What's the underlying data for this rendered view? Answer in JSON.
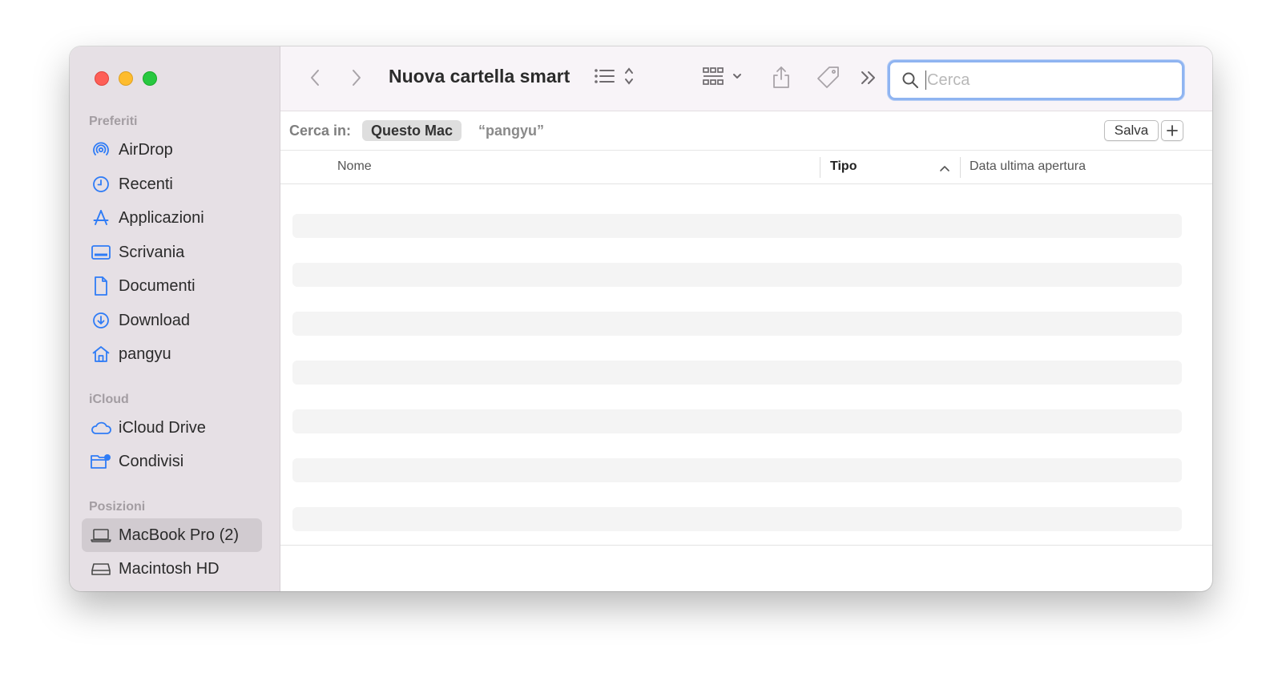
{
  "window": {
    "title": "Nuova cartella smart"
  },
  "sidebar": {
    "sections": {
      "favorites": "Preferiti",
      "icloud": "iCloud",
      "locations": "Posizioni"
    },
    "favorites": [
      {
        "label": "AirDrop",
        "icon": "airdrop-icon"
      },
      {
        "label": "Recenti",
        "icon": "clock-icon"
      },
      {
        "label": "Applicazioni",
        "icon": "apps-icon"
      },
      {
        "label": "Scrivania",
        "icon": "desktop-icon"
      },
      {
        "label": "Documenti",
        "icon": "document-icon"
      },
      {
        "label": "Download",
        "icon": "download-icon"
      },
      {
        "label": "pangyu",
        "icon": "home-icon"
      }
    ],
    "icloud": [
      {
        "label": "iCloud Drive",
        "icon": "cloud-icon"
      },
      {
        "label": "Condivisi",
        "icon": "shared-folder-icon"
      }
    ],
    "locations": [
      {
        "label": "MacBook Pro (2)",
        "icon": "laptop-icon",
        "selected": true
      },
      {
        "label": "Macintosh HD",
        "icon": "disk-icon"
      }
    ]
  },
  "search": {
    "placeholder": "Cerca",
    "value": ""
  },
  "scope": {
    "label": "Cerca in:",
    "this_mac": "Questo Mac",
    "user_scope": "“pangyu”",
    "save": "Salva"
  },
  "columns": {
    "name": "Nome",
    "kind": "Tipo",
    "last_opened": "Data ultima apertura"
  },
  "colors": {
    "accent": "#2f7cf6",
    "sidebar_bg": "#e6e0e5",
    "toolbar_bg": "#f8f4f8"
  }
}
